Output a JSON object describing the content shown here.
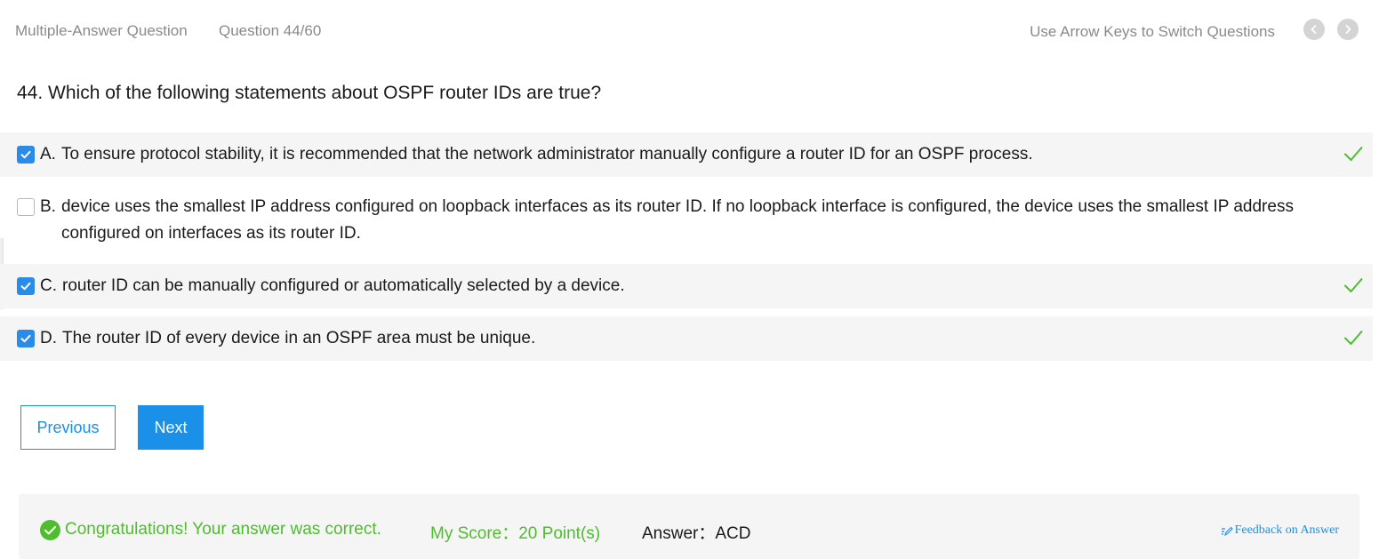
{
  "header": {
    "question_type": "Multiple-Answer Question",
    "question_number": "Question 44/60",
    "hint": "Use Arrow Keys to Switch Questions"
  },
  "question": {
    "text": "44. Which of the following statements about OSPF router IDs are true?"
  },
  "options": [
    {
      "letter": "A.",
      "text": "To ensure protocol stability, it is recommended that the network administrator manually configure a router ID for an OSPF process.",
      "checked": true,
      "correct": true
    },
    {
      "letter": "B.",
      "text": "device uses the smallest IP address configured on loopback interfaces as its router ID. If no loopback interface is configured, the device uses the smallest IP address configured on interfaces as its router ID.",
      "checked": false,
      "correct": false
    },
    {
      "letter": "C.",
      "text": "router ID can be manually configured or automatically selected by a device.",
      "checked": true,
      "correct": true
    },
    {
      "letter": "D.",
      "text": "The router ID of every device in an OSPF area must be unique.",
      "checked": true,
      "correct": true
    }
  ],
  "buttons": {
    "previous": "Previous",
    "next": "Next"
  },
  "result": {
    "message": "Congratulations! Your answer was correct.",
    "score": "My Score：20 Point(s)",
    "answer": "Answer：ACD",
    "feedback": "Feedback on Answer"
  },
  "colors": {
    "accent": "#1a90e8",
    "success": "#4ebd2e",
    "checkbox": "#2b8ce8"
  },
  "icons": [
    "chevron-left-icon",
    "chevron-right-icon",
    "checkbox-icon",
    "checkmark-icon",
    "check-circle-icon",
    "edit-icon"
  ]
}
